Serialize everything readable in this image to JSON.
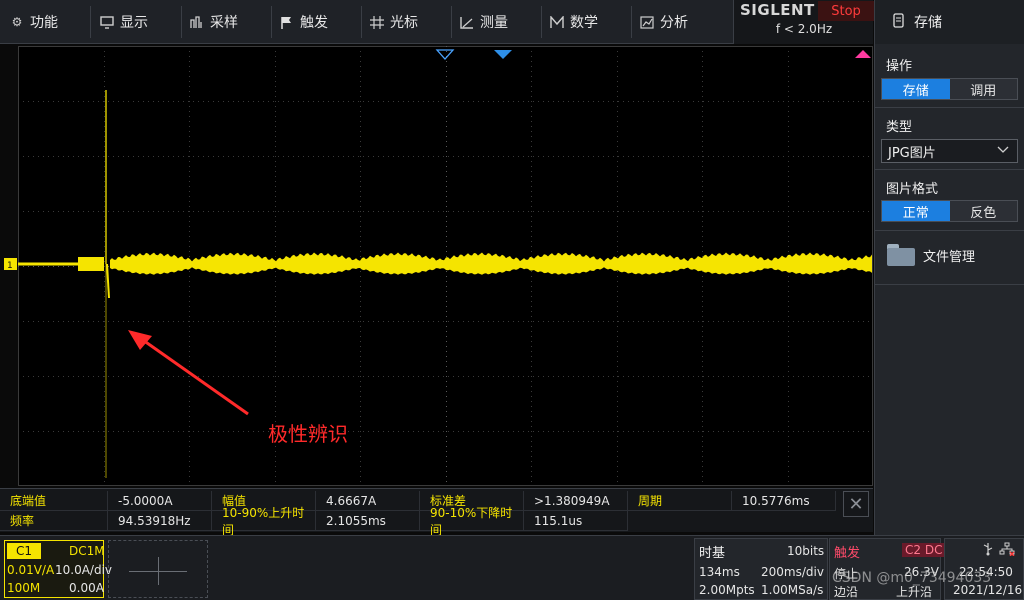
{
  "menu": {
    "items": [
      {
        "label": "功能",
        "icon": "gear-icon"
      },
      {
        "label": "显示",
        "icon": "display-icon"
      },
      {
        "label": "采样",
        "icon": "sample-icon"
      },
      {
        "label": "触发",
        "icon": "flag-icon"
      },
      {
        "label": "光标",
        "icon": "cursor-icon"
      },
      {
        "label": "测量",
        "icon": "ruler-icon"
      },
      {
        "label": "数学",
        "icon": "math-icon"
      },
      {
        "label": "分析",
        "icon": "analysis-icon"
      }
    ]
  },
  "brand": {
    "name": "SIGLENT",
    "run_state": "Stop",
    "frequency": "f < 2.0Hz"
  },
  "panel": {
    "title": "存储",
    "title_icon": "storage-icon",
    "operation": {
      "label": "操作",
      "options": [
        "存储",
        "调用"
      ],
      "selected": 0
    },
    "type": {
      "label": "类型",
      "value": "JPG图片"
    },
    "image_format": {
      "label": "图片格式",
      "options": [
        "正常",
        "反色"
      ],
      "selected": 0
    },
    "file_manager": "文件管理"
  },
  "annotation": {
    "text": "极性辨识"
  },
  "measurements": {
    "row1": [
      {
        "label": "底端值",
        "value": "-5.0000A"
      },
      {
        "label": "幅值",
        "value": "4.6667A"
      },
      {
        "label": "标准差",
        "value": ">1.380949A"
      },
      {
        "label": "周期",
        "value": "10.5776ms"
      }
    ],
    "row2": [
      {
        "label": "频率",
        "value": "94.53918Hz"
      },
      {
        "label": "10-90%上升时间",
        "value": "2.1055ms"
      },
      {
        "label": "90-10%下降时间",
        "value": "115.1us"
      }
    ]
  },
  "channel1": {
    "tag": "C1",
    "coupling": "DC1M",
    "probe": "0.01V/A",
    "scale": "10.0A/div",
    "bandwidth": "100M",
    "offset": "0.00A"
  },
  "timebase": {
    "title": "时基",
    "bits": "10bits",
    "delay": "134ms",
    "time_div": "200ms/div",
    "memory": "2.00Mpts",
    "sample_rate": "1.00MSa/s"
  },
  "trigger": {
    "title": "触发",
    "source": "C2 DC",
    "mode": "停止",
    "level": "26.3V",
    "type": "边沿",
    "slope": "上升沿"
  },
  "system": {
    "time": "22:54:50",
    "date": "2021/12/16"
  },
  "watermark": "CSDN @m0_73494033",
  "colors": {
    "trace": "#f5e400",
    "accent": "#1c7fe0",
    "stop": "#ff3b3b",
    "annotation": "#ff2a2a"
  }
}
